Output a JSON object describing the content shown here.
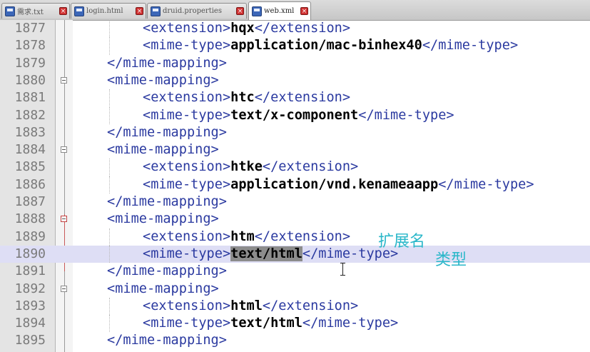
{
  "tabs": [
    {
      "label": "需求.txt",
      "active": false
    },
    {
      "label": "login.html",
      "active": false
    },
    {
      "label": "druid.properties",
      "active": false
    },
    {
      "label": "web.xml",
      "active": true
    }
  ],
  "editor": {
    "highlighted_line": 1890,
    "lines": [
      {
        "num": "1877",
        "indent": 2,
        "open": "<extension>",
        "value": "hqx",
        "close": "</extension>"
      },
      {
        "num": "1878",
        "indent": 2,
        "open": "<mime-type>",
        "value": "application/mac-binhex40",
        "close": "</mime-type>"
      },
      {
        "num": "1879",
        "indent": 1,
        "open": "</mime-mapping>",
        "value": "",
        "close": ""
      },
      {
        "num": "1880",
        "indent": 1,
        "open": "<mime-mapping>",
        "value": "",
        "close": "",
        "fold": true
      },
      {
        "num": "1881",
        "indent": 2,
        "open": "<extension>",
        "value": "htc",
        "close": "</extension>"
      },
      {
        "num": "1882",
        "indent": 2,
        "open": "<mime-type>",
        "value": "text/x-component",
        "close": "</mime-type>"
      },
      {
        "num": "1883",
        "indent": 1,
        "open": "</mime-mapping>",
        "value": "",
        "close": ""
      },
      {
        "num": "1884",
        "indent": 1,
        "open": "<mime-mapping>",
        "value": "",
        "close": "",
        "fold": true
      },
      {
        "num": "1885",
        "indent": 2,
        "open": "<extension>",
        "value": "htke",
        "close": "</extension>"
      },
      {
        "num": "1886",
        "indent": 2,
        "open": "<mime-type>",
        "value": "application/vnd.kenameaapp",
        "close": "</mime-type>"
      },
      {
        "num": "1887",
        "indent": 1,
        "open": "</mime-mapping>",
        "value": "",
        "close": ""
      },
      {
        "num": "1888",
        "indent": 1,
        "open": "<mime-mapping>",
        "value": "",
        "close": "",
        "fold": true,
        "fold_red": true
      },
      {
        "num": "1889",
        "indent": 2,
        "open": "<extension>",
        "value": "htm",
        "close": "</extension>"
      },
      {
        "num": "1890",
        "indent": 2,
        "open": "<mime-type>",
        "value": "text/html",
        "close": "</mime-type>",
        "selected": true
      },
      {
        "num": "1891",
        "indent": 1,
        "open": "</mime-mapping>",
        "value": "",
        "close": ""
      },
      {
        "num": "1892",
        "indent": 1,
        "open": "<mime-mapping>",
        "value": "",
        "close": "",
        "fold": true
      },
      {
        "num": "1893",
        "indent": 2,
        "open": "<extension>",
        "value": "html",
        "close": "</extension>"
      },
      {
        "num": "1894",
        "indent": 2,
        "open": "<mime-type>",
        "value": "text/html",
        "close": "</mime-type>"
      },
      {
        "num": "1895",
        "indent": 1,
        "open": "</mime-mapping>",
        "value": "",
        "close": ""
      }
    ]
  },
  "annotations": {
    "extension_note": "扩展名",
    "type_note": "类型"
  },
  "colors": {
    "tag": "#2b3aa0",
    "value": "#000000",
    "current_line": "#dedef5",
    "annotation": "#29b7c9"
  }
}
